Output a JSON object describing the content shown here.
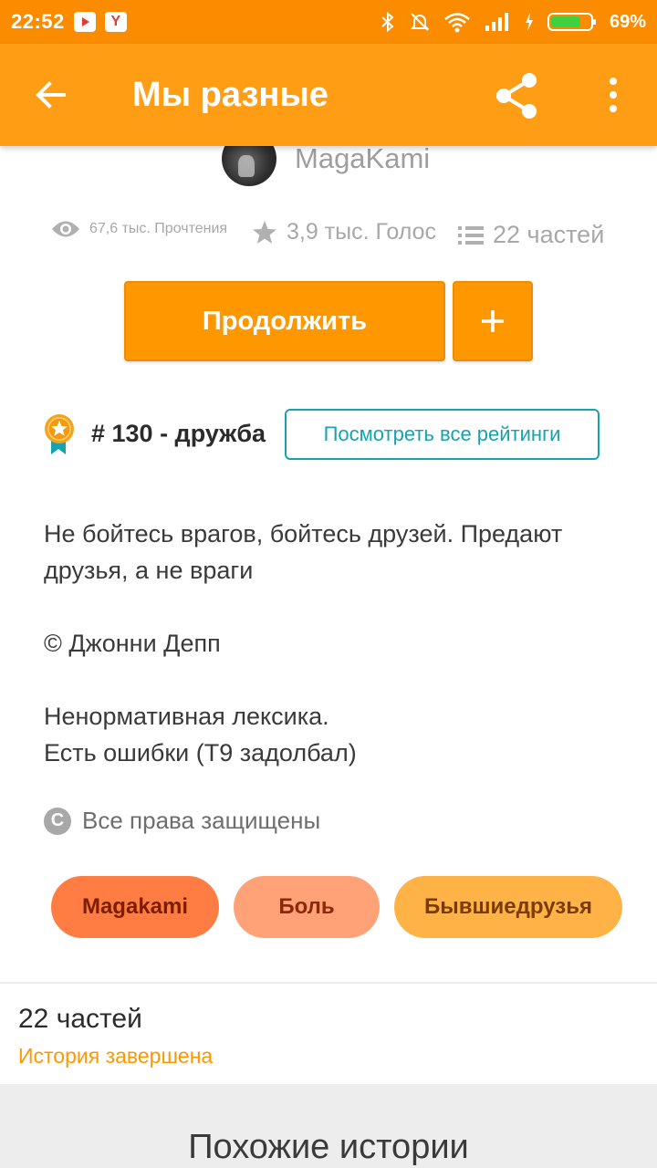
{
  "status_bar": {
    "time": "22:52",
    "battery_percent": "69%",
    "icons": [
      "youtube-icon",
      "yandex-icon",
      "bluetooth-icon",
      "mute-alarm-icon",
      "wifi-icon",
      "signal-icon",
      "charging-icon",
      "battery-icon"
    ]
  },
  "app_bar": {
    "title": "Мы разные",
    "icons": [
      "back-arrow-icon",
      "share-icon",
      "more-vert-icon"
    ]
  },
  "author": {
    "name": "MagaKami"
  },
  "stats": {
    "reads": "67,6 тыс. Прочтения",
    "votes": "3,9 тыс. Голос",
    "parts": "22 частей"
  },
  "actions": {
    "continue_label": "Продолжить",
    "add_label": "+"
  },
  "ranking": {
    "text": "# 130 - дружба",
    "view_all_label": "Посмотреть все рейтинги"
  },
  "description": {
    "line1": "Не бойтесь врагов, бойтесь друзей. Предают",
    "line2": "друзья, а не враги",
    "line3": "© Джонни Депп",
    "line4": "Ненормативная лексика.",
    "line5": "Есть ошибки (Т9 задолбал)"
  },
  "rights": {
    "icon_letter": "C",
    "text": "Все права защищены"
  },
  "tags": [
    "Magakami",
    "Боль",
    "Бывшиедрузья"
  ],
  "parts_section": {
    "count": "22 частей",
    "status": "История завершена"
  },
  "similar": {
    "title": "Похожие истории"
  },
  "colors": {
    "status_bar": "#fb8c00",
    "app_bar": "#ff9d15",
    "primary_button": "#ff9800",
    "ratings_outline": "#17a2b0",
    "tag_1": "#ff7c43",
    "tag_2": "#ffa277",
    "tag_3": "#ffb347"
  }
}
